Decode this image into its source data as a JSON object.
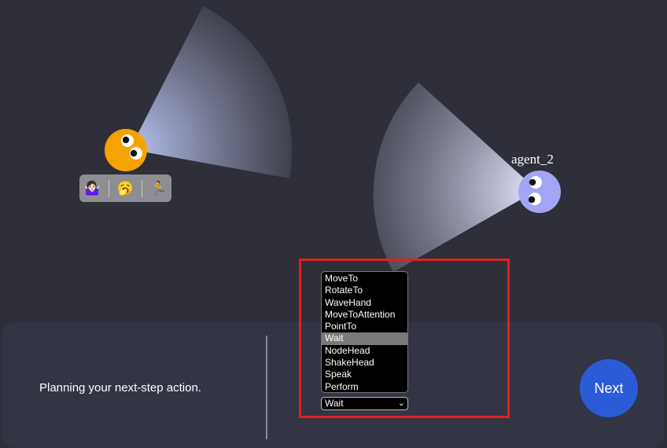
{
  "agents": [
    {
      "name": "",
      "color": "#f5a300"
    },
    {
      "name": "agent_2",
      "color": "#a4a4f4"
    }
  ],
  "emoji_bar": {
    "items": [
      {
        "icon": "person-shrugging-icon",
        "glyph": "🤷🏻‍♀️"
      },
      {
        "icon": "yawning-face-icon",
        "glyph": "🥱"
      },
      {
        "icon": "person-running-icon",
        "glyph": "🏃"
      }
    ]
  },
  "status": {
    "text": "Planning your next-step action."
  },
  "action_list": {
    "options": [
      "MoveTo",
      "RotateTo",
      "WaveHand",
      "MoveToAttention",
      "PointTo",
      "Wait",
      "NodeHead",
      "ShakeHead",
      "Speak",
      "Perform"
    ],
    "selected": "Wait"
  },
  "action_select": {
    "value": "Wait"
  },
  "next_button": {
    "label": "Next",
    "color": "#2c5bd8"
  },
  "colors": {
    "background": "#2f2f3a",
    "panel": "#333544",
    "highlight": "#e02020"
  }
}
